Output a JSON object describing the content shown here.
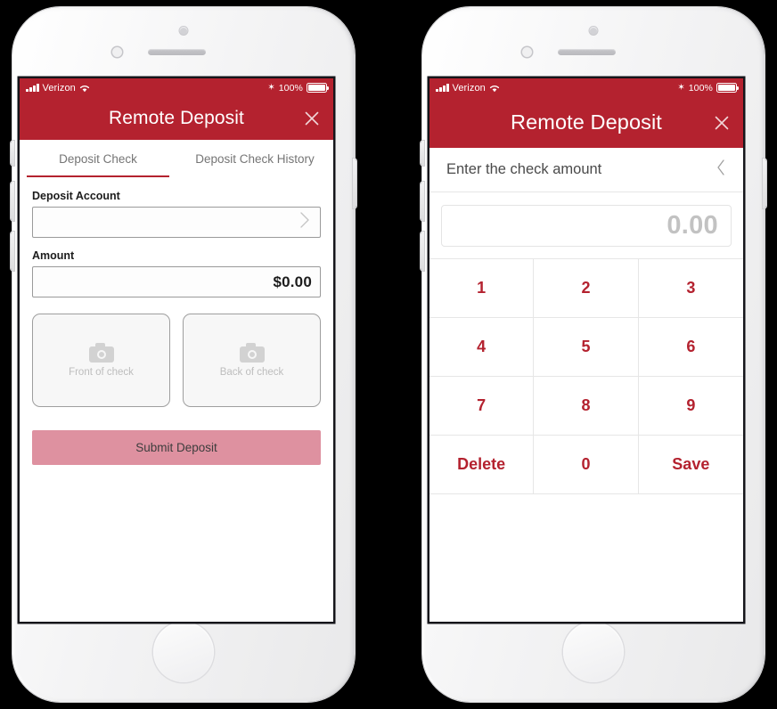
{
  "status_bar": {
    "carrier": "Verizon",
    "signal_icon": "signal-bars-icon",
    "wifi_icon": "wifi-icon",
    "bluetooth_icon": "bluetooth-icon",
    "bluetooth_glyph": "✶",
    "battery_percent": "100%",
    "battery_icon": "battery-full-icon"
  },
  "theme": {
    "brand_red": "#b4222f",
    "disabled_button_pink": "#de91a0",
    "key_text_red": "#b4222f",
    "placeholder_gray": "#c2c2c2"
  },
  "phone_left": {
    "header": {
      "title": "Remote Deposit",
      "close_icon": "close-icon"
    },
    "tabs": [
      {
        "label": "Deposit Check",
        "active": true
      },
      {
        "label": "Deposit Check History",
        "active": false
      }
    ],
    "form": {
      "deposit_account": {
        "label": "Deposit Account",
        "value": "",
        "chevron_icon": "chevron-right-icon"
      },
      "amount": {
        "label": "Amount",
        "value": "$0.00"
      }
    },
    "capture": [
      {
        "label": "Front of check",
        "icon": "camera-icon"
      },
      {
        "label": "Back of check",
        "icon": "camera-icon"
      }
    ],
    "submit_button": {
      "label": "Submit Deposit",
      "enabled": false
    }
  },
  "phone_right": {
    "header": {
      "title": "Remote Deposit",
      "close_icon": "close-icon"
    },
    "keypad_header": {
      "title": "Enter the check amount",
      "back_icon": "chevron-left-icon"
    },
    "amount_display": {
      "placeholder": "0.00",
      "value": ""
    },
    "keys": [
      "1",
      "2",
      "3",
      "4",
      "5",
      "6",
      "7",
      "8",
      "9",
      "Delete",
      "0",
      "Save"
    ]
  }
}
